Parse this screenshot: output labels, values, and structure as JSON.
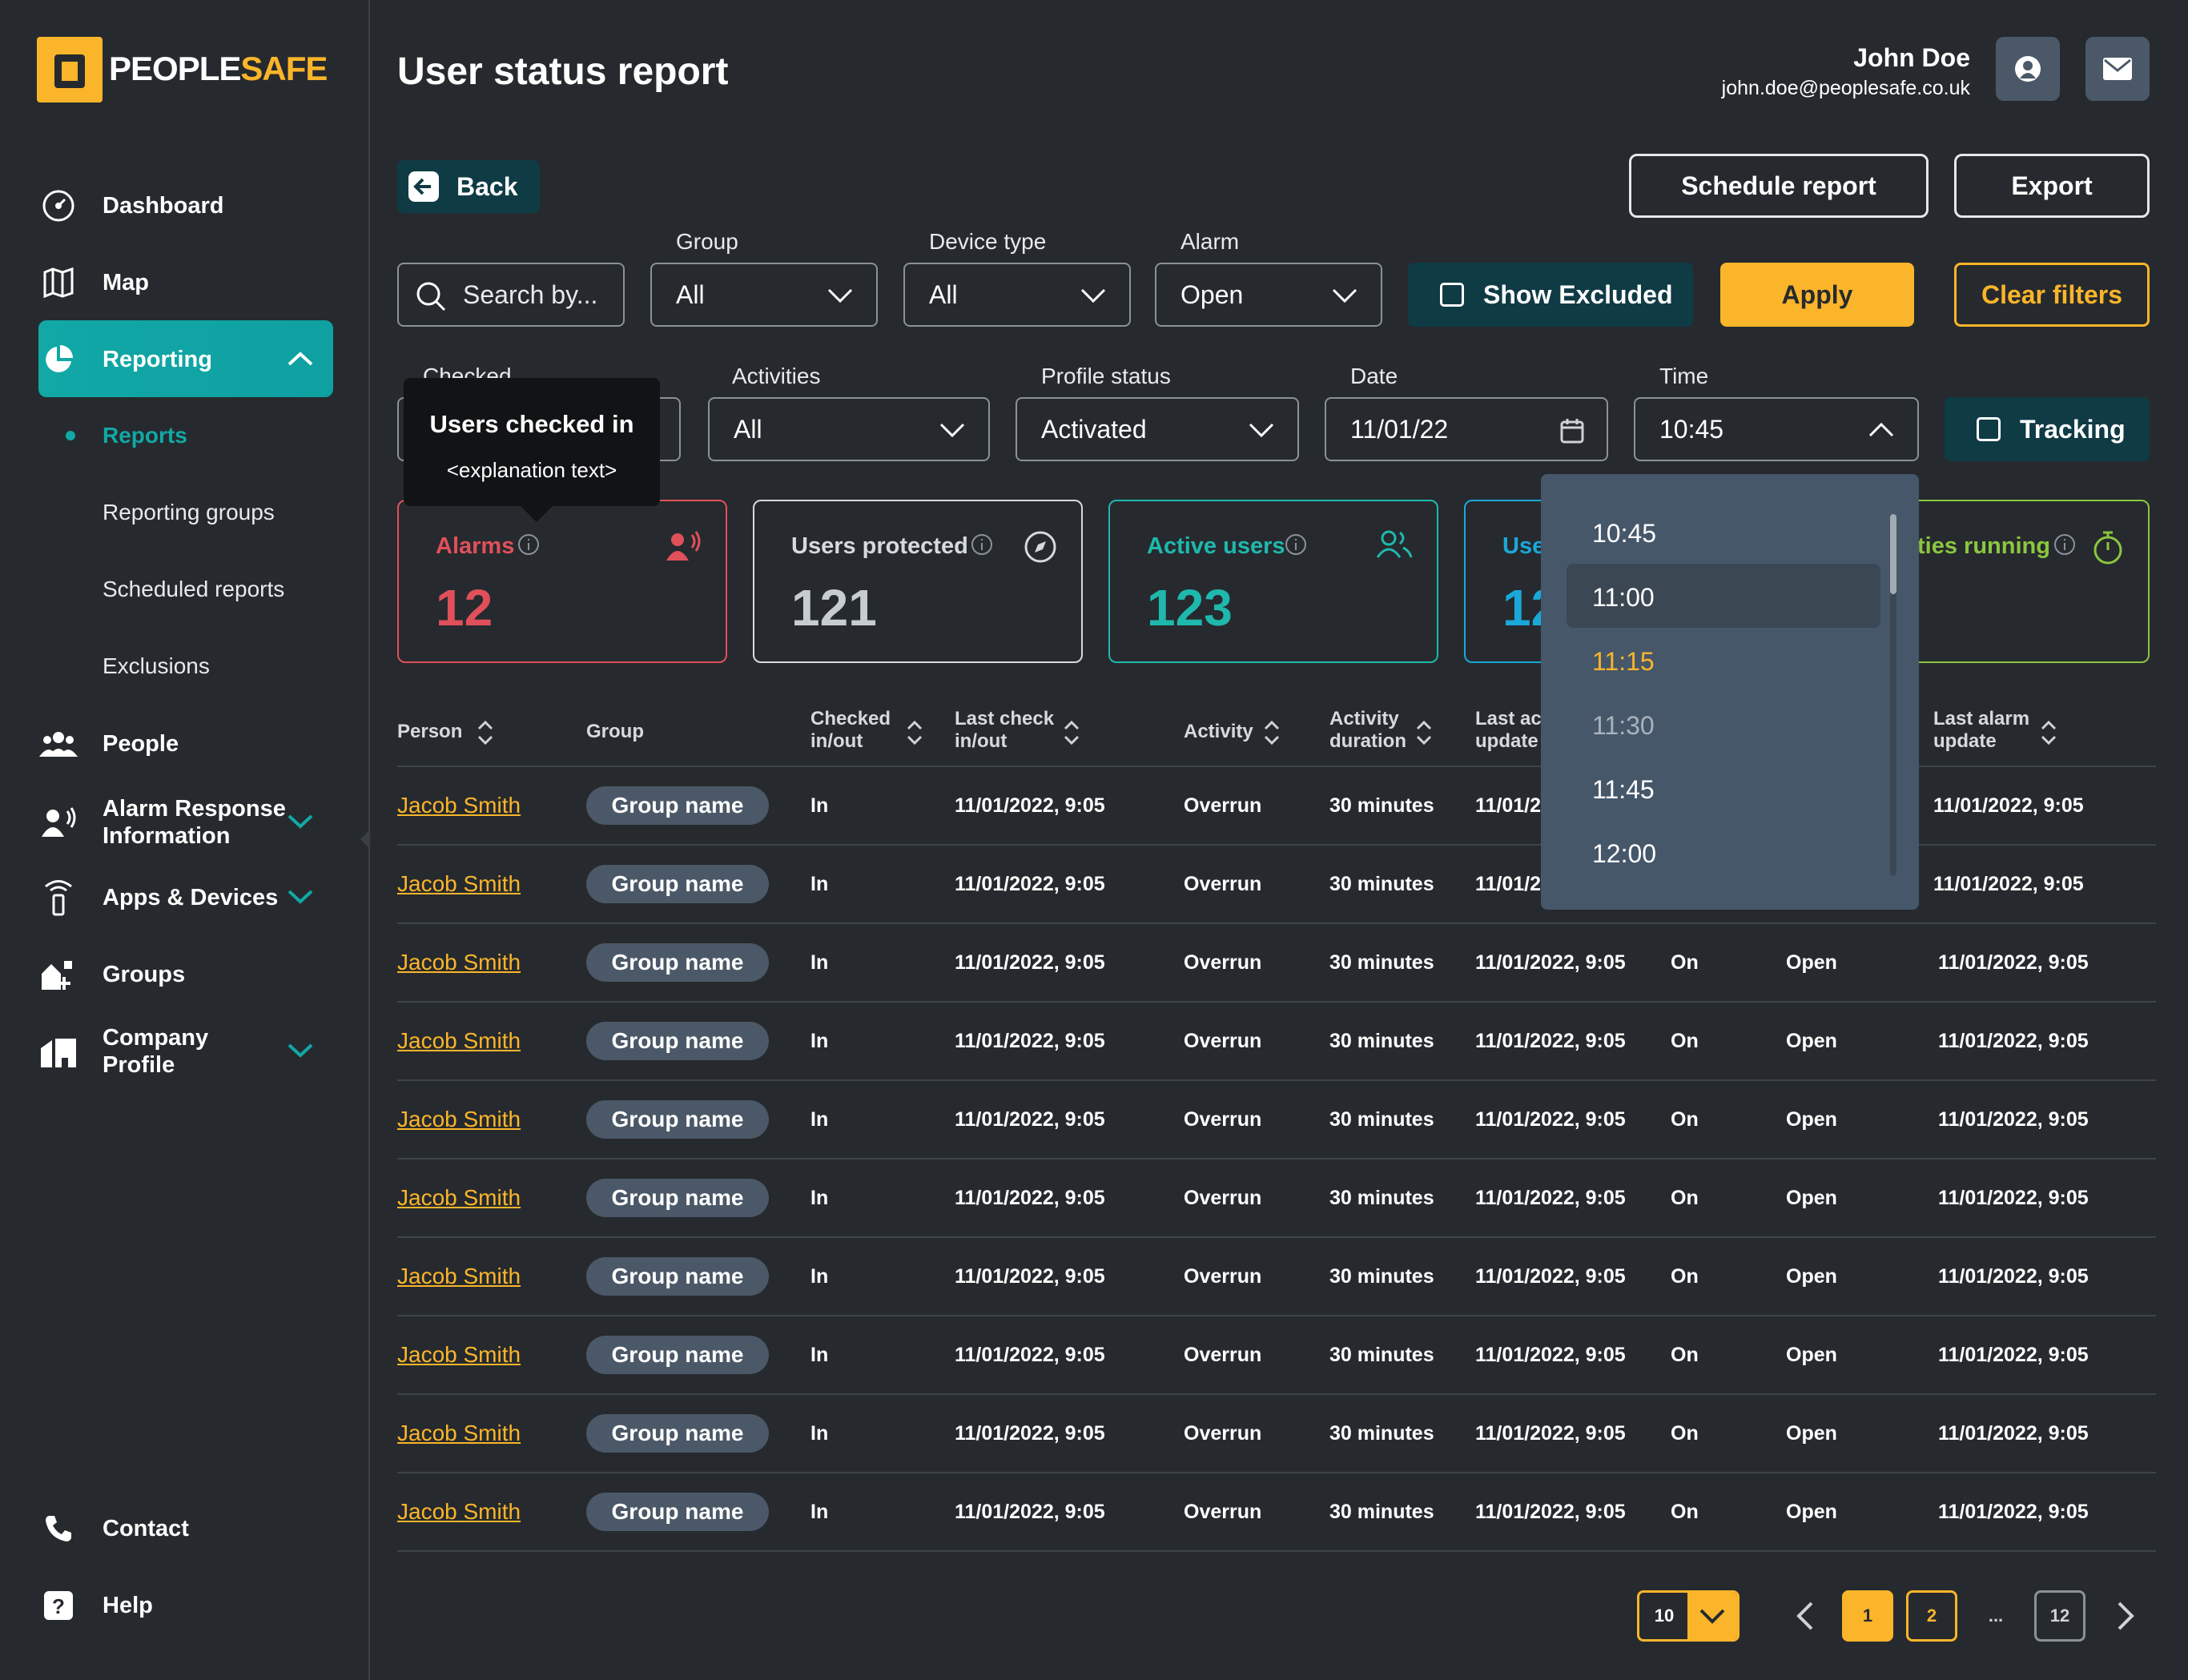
{
  "brand": {
    "name_a": "PEOPLE",
    "name_b": "SAFE"
  },
  "sidebar": {
    "items": [
      {
        "label": "Dashboard"
      },
      {
        "label": "Map"
      },
      {
        "label": "Reporting"
      },
      {
        "label": "People"
      },
      {
        "label": "Alarm Response Information"
      },
      {
        "label": "Apps & Devices"
      },
      {
        "label": "Groups"
      },
      {
        "label": "Company Profile"
      }
    ],
    "reporting_sub": [
      "Reports",
      "Reporting groups",
      "Scheduled reports",
      "Exclusions"
    ],
    "bottom": [
      {
        "label": "Contact"
      },
      {
        "label": "Help"
      }
    ]
  },
  "header": {
    "title": "User status report",
    "user_name": "John Doe",
    "user_email": "john.doe@peoplesafe.co.uk"
  },
  "actions": {
    "back": "Back",
    "schedule": "Schedule report",
    "export": "Export"
  },
  "filters": {
    "search_placeholder": "Search by...",
    "group": {
      "label": "Group",
      "value": "All"
    },
    "device_type": {
      "label": "Device type",
      "value": "All"
    },
    "alarm": {
      "label": "Alarm",
      "value": "Open"
    },
    "show_excluded": "Show Excluded",
    "apply": "Apply",
    "clear": "Clear filters",
    "checked": {
      "label": "Checked"
    },
    "activities": {
      "label": "Activities",
      "value": "All"
    },
    "profile_status": {
      "label": "Profile status",
      "value": "Activated"
    },
    "date": {
      "label": "Date",
      "value": "11/01/22"
    },
    "time": {
      "label": "Time",
      "value": "10:45"
    },
    "tracking": "Tracking"
  },
  "tooltip": {
    "title": "Users checked in",
    "body": "<explanation text>"
  },
  "cards": [
    {
      "label": "Alarms",
      "value": "12",
      "color": "#e0505a"
    },
    {
      "label": "Users protected",
      "value": "121",
      "color": "#d7dadd"
    },
    {
      "label": "Active users",
      "value": "123",
      "color": "#1fb8ad"
    },
    {
      "label": "Use",
      "value": "12",
      "color": "#1aa8d8"
    },
    {
      "label": "ties running",
      "value": "",
      "color": "#8cc63f"
    }
  ],
  "time_options": [
    "10:45",
    "11:00",
    "11:15",
    "11:30",
    "11:45",
    "12:00"
  ],
  "table": {
    "headers": [
      "Person",
      "Group",
      "Checked in/out",
      "Last check in/out",
      "Activity",
      "Activity duration",
      "Last ac update",
      "Last alarm update"
    ],
    "headers_lines": [
      [
        "Person"
      ],
      [
        "Group"
      ],
      [
        "Checked",
        "in/out"
      ],
      [
        "Last check",
        "in/out"
      ],
      [
        "Activity"
      ],
      [
        "Activity",
        "duration"
      ],
      [
        "Last ac",
        "update"
      ],
      [
        "Last alarm",
        "update"
      ]
    ],
    "rows": [
      {
        "person": "Jacob Smith",
        "group": "Group name",
        "checked": "In",
        "last_check": "11/01/2022, 9:05",
        "activity": "Overrun",
        "duration": "30 minutes",
        "last_activity": "11/01/2",
        "tracking": "",
        "alarm": "",
        "last_alarm": "11/01/2022, 9:05"
      },
      {
        "person": "Jacob Smith",
        "group": "Group name",
        "checked": "In",
        "last_check": "11/01/2022, 9:05",
        "activity": "Overrun",
        "duration": "30 minutes",
        "last_activity": "11/01/2",
        "tracking": "",
        "alarm": "",
        "last_alarm": "11/01/2022, 9:05"
      },
      {
        "person": "Jacob Smith",
        "group": "Group name",
        "checked": "In",
        "last_check": "11/01/2022, 9:05",
        "activity": "Overrun",
        "duration": "30 minutes",
        "last_activity": "11/01/2022, 9:05",
        "tracking": "On",
        "alarm": "Open",
        "last_alarm": "11/01/2022, 9:05"
      },
      {
        "person": "Jacob Smith",
        "group": "Group name",
        "checked": "In",
        "last_check": "11/01/2022, 9:05",
        "activity": "Overrun",
        "duration": "30 minutes",
        "last_activity": "11/01/2022, 9:05",
        "tracking": "On",
        "alarm": "Open",
        "last_alarm": "11/01/2022, 9:05"
      },
      {
        "person": "Jacob Smith",
        "group": "Group name",
        "checked": "In",
        "last_check": "11/01/2022, 9:05",
        "activity": "Overrun",
        "duration": "30 minutes",
        "last_activity": "11/01/2022, 9:05",
        "tracking": "On",
        "alarm": "Open",
        "last_alarm": "11/01/2022, 9:05"
      },
      {
        "person": "Jacob Smith",
        "group": "Group name",
        "checked": "In",
        "last_check": "11/01/2022, 9:05",
        "activity": "Overrun",
        "duration": "30 minutes",
        "last_activity": "11/01/2022, 9:05",
        "tracking": "On",
        "alarm": "Open",
        "last_alarm": "11/01/2022, 9:05"
      },
      {
        "person": "Jacob Smith",
        "group": "Group name",
        "checked": "In",
        "last_check": "11/01/2022, 9:05",
        "activity": "Overrun",
        "duration": "30 minutes",
        "last_activity": "11/01/2022, 9:05",
        "tracking": "On",
        "alarm": "Open",
        "last_alarm": "11/01/2022, 9:05"
      },
      {
        "person": "Jacob Smith",
        "group": "Group name",
        "checked": "In",
        "last_check": "11/01/2022, 9:05",
        "activity": "Overrun",
        "duration": "30 minutes",
        "last_activity": "11/01/2022, 9:05",
        "tracking": "On",
        "alarm": "Open",
        "last_alarm": "11/01/2022, 9:05"
      },
      {
        "person": "Jacob Smith",
        "group": "Group name",
        "checked": "In",
        "last_check": "11/01/2022, 9:05",
        "activity": "Overrun",
        "duration": "30 minutes",
        "last_activity": "11/01/2022, 9:05",
        "tracking": "On",
        "alarm": "Open",
        "last_alarm": "11/01/2022, 9:05"
      },
      {
        "person": "Jacob Smith",
        "group": "Group name",
        "checked": "In",
        "last_check": "11/01/2022, 9:05",
        "activity": "Overrun",
        "duration": "30 minutes",
        "last_activity": "11/01/2022, 9:05",
        "tracking": "On",
        "alarm": "Open",
        "last_alarm": "11/01/2022, 9:05"
      }
    ]
  },
  "pagination": {
    "page_size": "10",
    "pages": [
      "1",
      "2",
      "...",
      "12"
    ],
    "current": "1"
  },
  "colors": {
    "accent": "#fbb52a",
    "teal": "#11a8a6",
    "bg": "#262a2e"
  }
}
